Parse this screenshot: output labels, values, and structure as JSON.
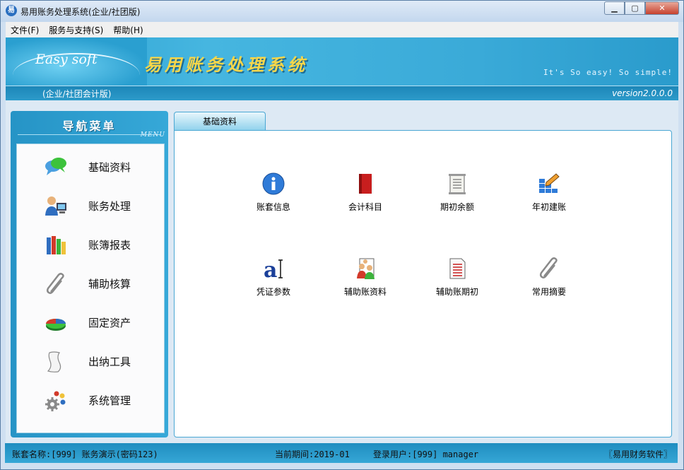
{
  "window": {
    "title": "易用账务处理系统(企业/社团版)",
    "app_icon_text": "易"
  },
  "menu": [
    {
      "label": "文件(F)"
    },
    {
      "label": "服务与支持(S)"
    },
    {
      "label": "帮助(H)"
    }
  ],
  "banner": {
    "logo_text": "Easy soft",
    "title": "易用账务处理系统",
    "slogan": "It's So easy! So simple!",
    "edition": "(企业/社团会计版)",
    "version": "version2.0.0.0"
  },
  "nav": {
    "title": "导航菜单",
    "subtitle": "MENU",
    "items": [
      {
        "label": "基础资料",
        "icon": "chat-bubbles-icon"
      },
      {
        "label": "账务处理",
        "icon": "user-computer-icon"
      },
      {
        "label": "账簿报表",
        "icon": "books-icon"
      },
      {
        "label": "辅助核算",
        "icon": "paperclip-icon"
      },
      {
        "label": "固定资产",
        "icon": "pie-chart-icon"
      },
      {
        "label": "出纳工具",
        "icon": "scroll-icon"
      },
      {
        "label": "系统管理",
        "icon": "gear-icon"
      }
    ]
  },
  "tab": {
    "label": "基础资料"
  },
  "tiles": [
    {
      "label": "账套信息",
      "icon": "info-icon"
    },
    {
      "label": "会计科目",
      "icon": "red-book-icon"
    },
    {
      "label": "期初余额",
      "icon": "document-scroll-icon"
    },
    {
      "label": "年初建账",
      "icon": "grid-pencil-icon"
    },
    {
      "label": "凭证参数",
      "icon": "text-cursor-icon"
    },
    {
      "label": "辅助账资料",
      "icon": "users-document-icon"
    },
    {
      "label": "辅助账期初",
      "icon": "list-document-icon"
    },
    {
      "label": "常用摘要",
      "icon": "paperclip-icon"
    }
  ],
  "status": {
    "account": "账套名称:[999] 账务演示(密码123)",
    "period": "当前期间:2019-01",
    "user": "登录用户:[999] manager",
    "brand": "〖易用财务软件〗"
  }
}
